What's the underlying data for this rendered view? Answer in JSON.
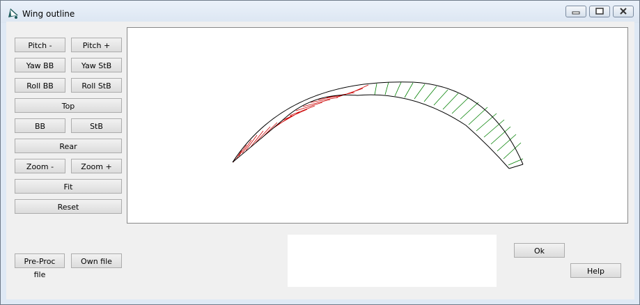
{
  "window": {
    "title": "Wing outline",
    "controls": {
      "minimize_icon": "minimize-icon",
      "restore_icon": "restore-icon",
      "close_icon": "close-icon"
    }
  },
  "buttons": {
    "pitch_minus": "Pitch -",
    "pitch_plus": "Pitch +",
    "yaw_bb": "Yaw BB",
    "yaw_stb": "Yaw StB",
    "roll_bb": "Roll BB",
    "roll_stb": "Roll StB",
    "top": "Top",
    "bb": "BB",
    "stb": "StB",
    "rear": "Rear",
    "zoom_minus": "Zoom -",
    "zoom_plus": "Zoom +",
    "fit": "Fit",
    "reset": "Reset",
    "pre_proc_file": "Pre-Proc file",
    "own_file": "Own file",
    "ok": "Ok",
    "help": "Help"
  },
  "colors": {
    "left_wing_half": "#cc0000",
    "right_wing_half": "#008000",
    "outline": "#000000",
    "window_frame": "#dfe9f5",
    "dialog_bg": "#f0f0f0"
  }
}
